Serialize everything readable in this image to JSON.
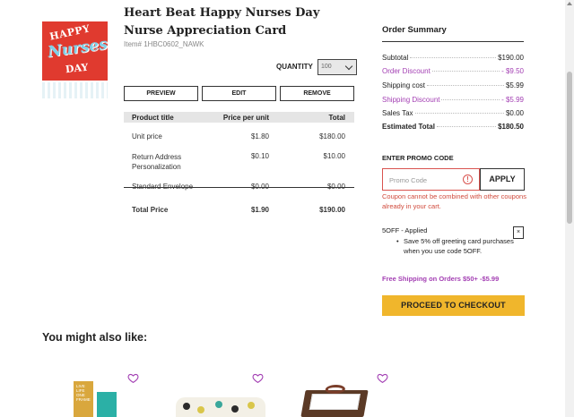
{
  "product": {
    "title": "Heart Beat Happy Nurses Day Nurse Appreciation Card",
    "item_number": "Item# 1HBC0602_NAWK",
    "thumbnail_text": [
      "HAPPY",
      "Nurses",
      "DAY"
    ],
    "quantity_label": "QUANTITY",
    "quantity_value": "100",
    "actions": {
      "preview": "PREVIEW",
      "edit": "EDIT",
      "remove": "REMOVE"
    }
  },
  "price_table": {
    "headers": [
      "Product title",
      "Price per unit",
      "Total"
    ],
    "rows": [
      {
        "title": "Unit price",
        "unit": "$1.80",
        "total": "$180.00"
      },
      {
        "title": "Return Address Personalization",
        "unit": "$0.10",
        "total": "$10.00"
      },
      {
        "title": "Standard Envelope",
        "unit": "$0.00",
        "total": "$0.00"
      }
    ],
    "total": {
      "title": "Total Price",
      "unit": "$1.90",
      "total": "$190.00"
    }
  },
  "order_summary": {
    "title": "Order Summary",
    "rows": [
      {
        "label": "Subtotal",
        "value": "$190.00",
        "style": "normal"
      },
      {
        "label": "Order Discount",
        "value": "- $9.50",
        "style": "purple"
      },
      {
        "label": "Shipping cost",
        "value": "$5.99",
        "style": "normal"
      },
      {
        "label": "Shipping Discount",
        "value": "- $5.99",
        "style": "purple"
      },
      {
        "label": "Sales Tax",
        "value": "$0.00",
        "style": "normal"
      },
      {
        "label": "Estimated Total",
        "value": "$180.50",
        "style": "bold"
      }
    ]
  },
  "promo": {
    "heading": "ENTER PROMO CODE",
    "placeholder": "Promo Code",
    "apply_label": "APPLY",
    "error": "Coupon cannot be combined with other coupons already in your cart.",
    "applied_title": "5OFF - Applied",
    "applied_close": "×",
    "applied_details": [
      "Save 5% off greeting card purchases when you use code 5OFF."
    ],
    "free_shipping": "Free Shipping on Orders $50+ -$5.99"
  },
  "checkout_label": "PROCEED TO CHECKOUT",
  "also_like_heading": "You might also like:",
  "recommendations": [
    {
      "image_text": "LIVE LIFE ONE FRAME"
    },
    {
      "image_text": ""
    },
    {
      "image_text": ""
    }
  ],
  "colors": {
    "accent_purple": "#a33fb3",
    "checkout_yellow": "#f0b62c",
    "error_red": "#d04a3c",
    "card_red": "#e03a2f"
  }
}
